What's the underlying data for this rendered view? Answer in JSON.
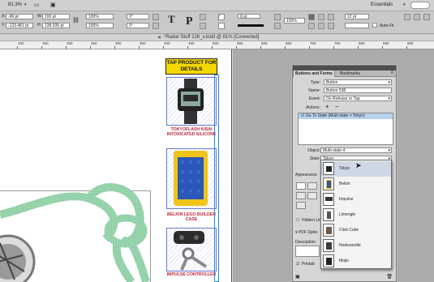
{
  "app": {
    "zoom": "81.3%",
    "workspace": "Essentials"
  },
  "control_bar": {
    "x_value": "-96 pt",
    "y_value": "-123.481 pt",
    "w_value": "100 pt",
    "h_value": "138.039 pt",
    "scale_x": "100%",
    "scale_y": "100%",
    "angle": "0°",
    "shear": "0°",
    "stroke_weight": "0 pt",
    "percent_a": "100%",
    "gap": "12 pt",
    "auto_fit": "Auto-Fit"
  },
  "document": {
    "title": "*Radar Stuff 226_v.indd @ 81% [Converted]"
  },
  "ruler": {
    "marks": [
      "100",
      "150",
      "200",
      "250",
      "300",
      "350",
      "400",
      "450",
      "500",
      "550",
      "600",
      "650",
      "700",
      "750",
      "800",
      "850",
      "900"
    ]
  },
  "layout": {
    "header": "TAP PRODUCT FOR DETAILS",
    "products": [
      {
        "caption": "TOKYOFLASH KISAI INTOXICATED SILICONE"
      },
      {
        "caption": "BELKIN LEGO BUILDER CASE"
      },
      {
        "caption": "IMPULSE CONTROLLER"
      }
    ]
  },
  "panel": {
    "tabs": [
      "Buttons and Forms",
      "Bookmarks"
    ],
    "type_label": "Type:",
    "type_value": "Button",
    "name_label": "Name:",
    "name_value": "Button 538",
    "event_label": "Event:",
    "event_value": "On Release or Tap",
    "actions_label": "Actions:",
    "add_action": "+",
    "remove_action": "−",
    "action_item": "Go To State (Multi-state > Tokyo)",
    "object_label": "Object:",
    "object_value": "Multi-state 4",
    "state_label": "State:",
    "state_value": "Tokyo",
    "appearance_label": "Appearance",
    "hidden_label": "Hidden Unt",
    "pdf_options_label": "PDF Optio",
    "description_label": "Description",
    "printable_label": "Printab"
  },
  "state_dropdown": {
    "items": [
      "Tokyo",
      "Belkin",
      "Impulse",
      "Limengle",
      "Click Cube",
      "Nodesoodle",
      "Mojio"
    ],
    "selected": "Tokyo"
  },
  "colors": {
    "header_yellow": "#f5d800",
    "caption_red": "#c0243b",
    "selection_blue": "#6a7ad0",
    "knot_green": "#8fcfa6"
  }
}
